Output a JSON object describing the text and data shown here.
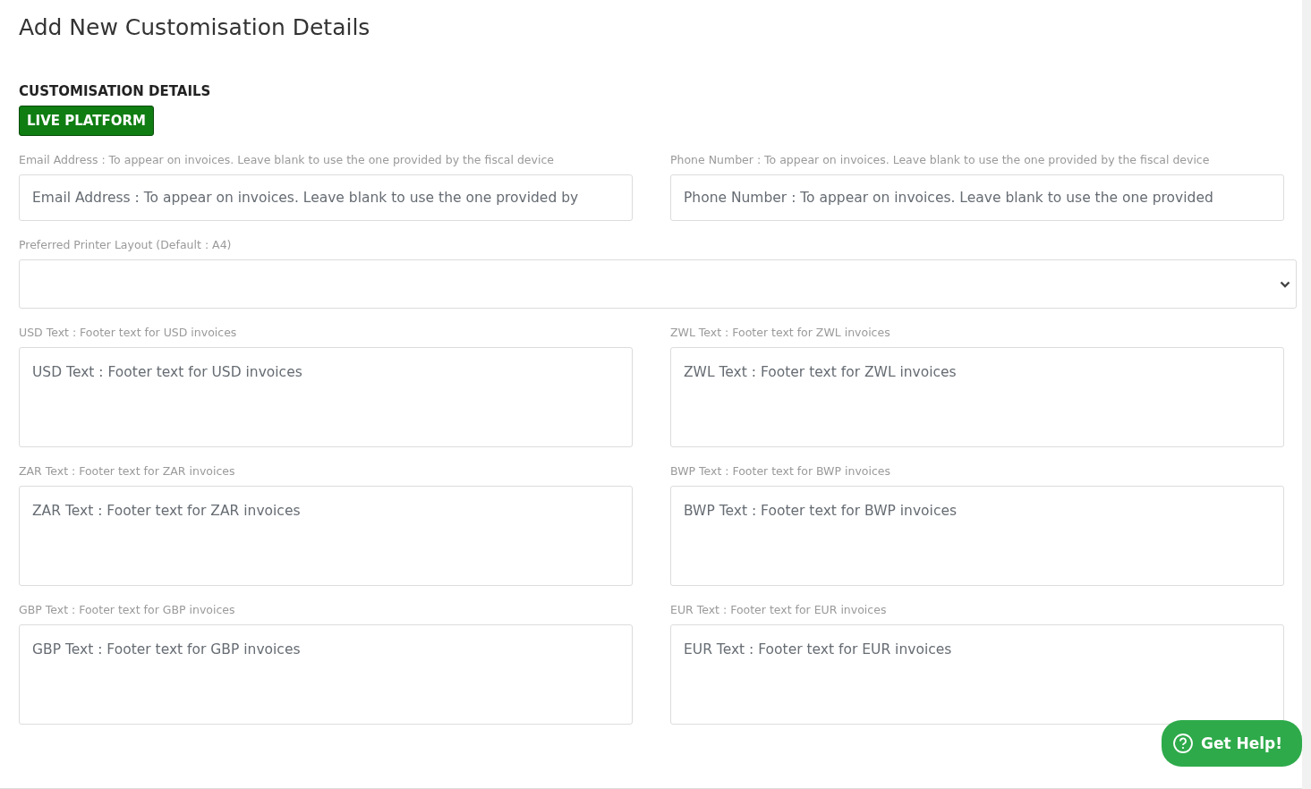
{
  "page_title": "Add New Customisation Details",
  "section_title": "CUSTOMISATION DETAILS",
  "platform_badge": "LIVE PLATFORM",
  "contact_fields": [
    {
      "label": "Email Address : To appear on invoices. Leave blank to use the one provided by the fiscal device",
      "placeholder": "Email Address : To appear on invoices. Leave blank to use the one provided by"
    },
    {
      "label": "Phone Number : To appear on invoices. Leave blank to use the one provided by the fiscal device",
      "placeholder": "Phone Number : To appear on invoices. Leave blank to use the one provided"
    }
  ],
  "printer_layout": {
    "label": "Preferred Printer Layout (Default : A4)"
  },
  "footer_fields": [
    {
      "label": "USD Text : Footer text for USD invoices",
      "placeholder": "USD Text : Footer text for USD invoices"
    },
    {
      "label": "ZWL Text : Footer text for ZWL invoices",
      "placeholder": "ZWL Text : Footer text for ZWL invoices"
    },
    {
      "label": "ZAR Text : Footer text for ZAR invoices",
      "placeholder": "ZAR Text : Footer text for ZAR invoices"
    },
    {
      "label": "BWP Text : Footer text for BWP invoices",
      "placeholder": "BWP Text : Footer text for BWP invoices"
    },
    {
      "label": "GBP Text : Footer text for GBP invoices",
      "placeholder": "GBP Text : Footer text for GBP invoices"
    },
    {
      "label": "EUR Text : Footer text for EUR invoices",
      "placeholder": "EUR Text : Footer text for EUR invoices"
    }
  ],
  "help_button": "Get Help!"
}
